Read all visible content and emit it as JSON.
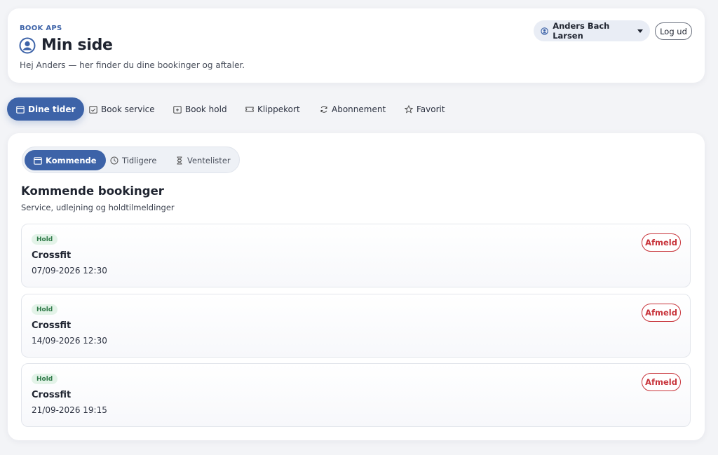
{
  "header": {
    "brand": "BOOK APS",
    "title": "Min side",
    "subtitle": "Hej Anders — her finder du dine bookinger og aftaler.",
    "user_name": "Anders Bach Larsen",
    "logout_label": "Log ud"
  },
  "main_tabs": [
    {
      "label": "Dine tider",
      "icon": "calendar-icon",
      "active": true
    },
    {
      "label": "Book service",
      "icon": "calendar-check-icon"
    },
    {
      "label": "Book hold",
      "icon": "calendar-plus-icon"
    },
    {
      "label": "Klippekort",
      "icon": "ticket-icon"
    },
    {
      "label": "Abonnement",
      "icon": "refresh-icon"
    },
    {
      "label": "Favorit",
      "icon": "star-icon"
    }
  ],
  "sub_tabs": [
    {
      "label": "Kommende",
      "icon": "calendar-icon",
      "active": true
    },
    {
      "label": "Tidligere",
      "icon": "clock-icon"
    },
    {
      "label": "Ventelister",
      "icon": "hourglass-icon"
    }
  ],
  "section": {
    "title": "Kommende bookinger",
    "subtitle": "Service, udlejning og holdtilmeldinger"
  },
  "bookings": [
    {
      "badge": "Hold",
      "title": "Crossfit",
      "datetime": "07/09-2026 12:30",
      "action": "Afmeld"
    },
    {
      "badge": "Hold",
      "title": "Crossfit",
      "datetime": "14/09-2026 12:30",
      "action": "Afmeld"
    },
    {
      "badge": "Hold",
      "title": "Crossfit",
      "datetime": "21/09-2026 19:15",
      "action": "Afmeld"
    }
  ],
  "colors": {
    "accent": "#3d63a8",
    "danger": "#c8343b",
    "badge_bg": "#e3f3e8",
    "badge_text": "#2f7a48"
  }
}
